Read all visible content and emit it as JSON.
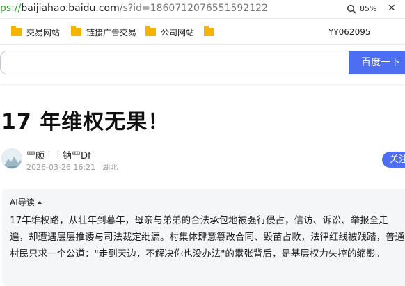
{
  "address_bar": {
    "url_proto": "ps://",
    "url_host": "baijiahao.baidu.com",
    "url_path": "/s?id=1860712076551592122",
    "zoom": "85%"
  },
  "bookmarks": {
    "items": [
      {
        "label": "交易网站"
      },
      {
        "label": "链接广告交易"
      },
      {
        "label": "公司网站"
      },
      {
        "label": ""
      }
    ],
    "right_label": "YY062095"
  },
  "search": {
    "button_label": "百度一下",
    "placeholder": ""
  },
  "article": {
    "title": "17 年维权无果！",
    "author": "罒颇丨丨钠罒Df",
    "date": "2026-03-26 16:21",
    "location": "湖北",
    "follow_label": "关注"
  },
  "ai_summary": {
    "header": "AI导读",
    "text": "17年维权路，从壮年到暮年，母亲与弟弟的合法承包地被强行侵占，信访、诉讼、举报全走遍，却遭遇层层推诿与司法裁定纰漏。村集体肆意篡改合同、毁苗占款，法律红线被践踏，普通村民只求一个公道：\"走到天边，不解决你也没办法\"的嚣张背后，是基层权力失控的缩影。"
  },
  "colors": {
    "accent": "#4e6ef2",
    "folder": "#f5b400",
    "https_green": "#2aa52a"
  }
}
